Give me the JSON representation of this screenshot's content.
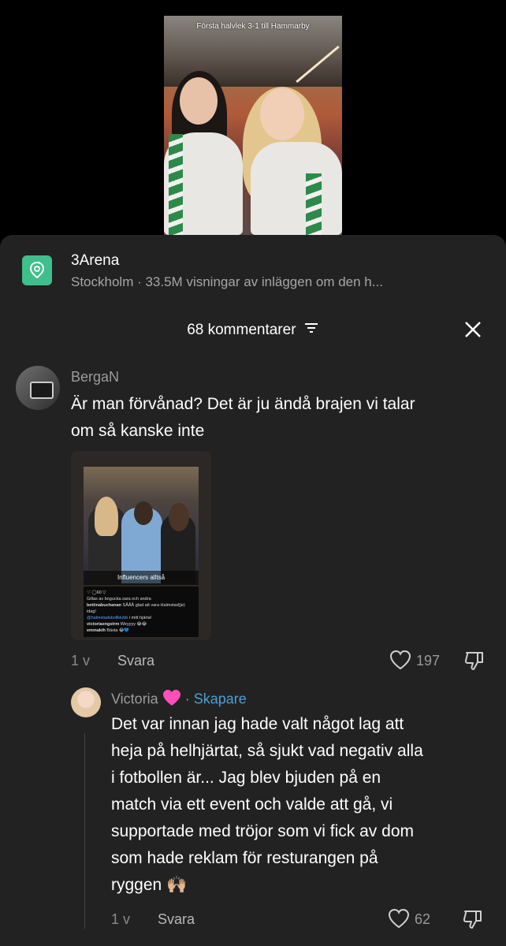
{
  "video": {
    "caption": "Första halvlek 3-1 till Hammarby"
  },
  "place": {
    "icon": "location-pin-icon",
    "title": "3Arena",
    "subtitle": "Stockholm · 33.5M visningar av inläggen om den h..."
  },
  "comments_header": {
    "label": "68 kommentarer"
  },
  "comments": [
    {
      "username": "BergaN",
      "text_line1": "Är man förvånad? Det är ju ändå brajen vi talar",
      "text_line2": "om så kanske inte",
      "attachment": {
        "label": "Influencers alltså",
        "ig_count": "60",
        "ig_liked": "Gillas av bogucka.sara och andra",
        "ig_user": "bettinabuchanan",
        "ig_caption": "SÅÅÅ glad att vara Halmstad(je) idag!",
        "ig_tag": "@halmstadsbollklubb",
        "ig_tag_suffix": "i mitt hjärta!",
        "ig_c1_user": "victoriaengstrm",
        "ig_c1": "Weyyyy 😂😂",
        "ig_c2_user": "emmakih",
        "ig_c2": "Bästa 😂💙"
      },
      "age": "1 v",
      "reply": "Svara",
      "likes": "197"
    },
    {
      "username": "Victoria",
      "creator_tag": "Skapare",
      "lines": [
        "Det var innan jag hade valt något lag att",
        "heja på helhjärtat, så sjukt vad negativ alla",
        "i fotbollen är... Jag blev bjuden på en",
        "match via ett event och valde att gå, vi",
        "supportade med tröjor som vi fick av dom",
        "som hade reklam för resturangen på",
        "ryggen 🙌🏼"
      ],
      "age": "1 v",
      "reply": "Svara",
      "likes": "62"
    }
  ],
  "colors": {
    "sheet": "#222222",
    "accent_place": "#3fbf8b",
    "creator": "#4ba0d6"
  }
}
